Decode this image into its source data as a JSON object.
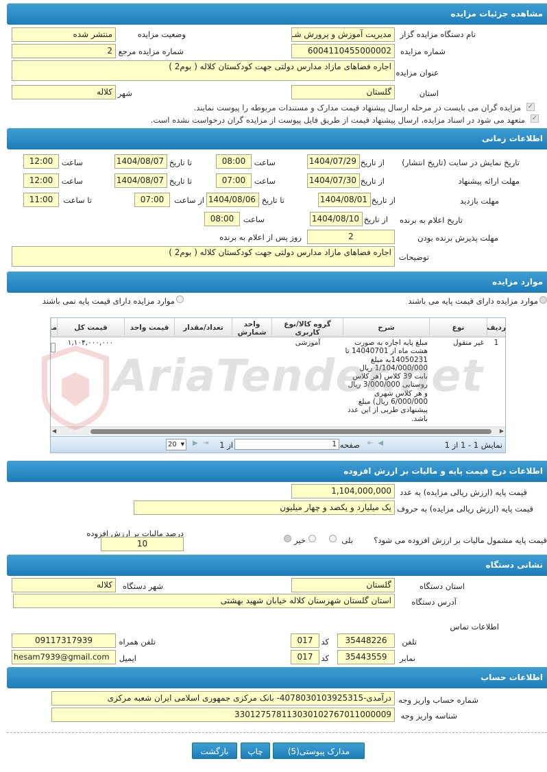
{
  "sections": {
    "details": "مشاهده جزئیات مزایده",
    "timing": "اطلاعات زمانی",
    "items": "موارد مزایده",
    "price": "اطلاعات درج قیمت پایه و مالیات بر ارزش افزوده",
    "address": "نشانی دستگاه",
    "account": "اطلاعات حساب"
  },
  "details": {
    "org_label": "نام دستگاه مزایده گزار",
    "org_value": "مدیریت آموزش و پرورش شـ",
    "status_label": "وضعیت مزایده",
    "status_value": "منتشر شده",
    "number_label": "شماره مزایده",
    "number_value": "6004110455000002",
    "ref_label": "شماره مزایده مرجع",
    "ref_value": "2",
    "title_label": "عنوان مزایده",
    "title_value": "اجاره فضاهای مازاد مدارس دولتی جهت کودکستان کلاله ( بوم2 )",
    "province_label": "استان",
    "province_value": "گلستان",
    "city_label": "شهر",
    "city_value": "کلاله",
    "check1": "مزایده گران می بایست در مرحله ارسال پیشنهاد قیمت مدارک و مستندات مربوطه را پیوست نمایند.",
    "check2": "متعهد می شود در اسناد مزایده، ارسال پیشنهاد قیمت از طریق فایل پیوست از مزایده گران درخواست نشده است."
  },
  "timing": {
    "publish_label": "تاریخ نمایش در سایت (تاریخ انتشار)",
    "from_label": "از تاریخ",
    "to_label": "تا تاریخ",
    "hour_label": "ساعت",
    "publish_from": "1404/07/29",
    "publish_from_time": "08:00",
    "publish_to": "1404/08/07",
    "publish_to_time": "12:00",
    "offer_label": "مهلت ارائه پیشنهاد",
    "offer_from": "1404/07/30",
    "offer_from_time": "07:00",
    "offer_to": "1404/08/07",
    "offer_to_time": "12:00",
    "visit_label": "مهلت بازدید",
    "visit_from": "1404/08/01",
    "visit_to": "1404/08/06",
    "visit_from_hour_label": "از ساعت",
    "visit_from_time": "07:00",
    "visit_to_hour_label": "تا ساعت",
    "visit_to_time": "11:00",
    "winner_label": "تاریخ اعلام به برنده",
    "winner_date": "1404/08/10",
    "winner_time": "08:00",
    "accept_label": "مهلت پذیرش برنده بودن",
    "accept_days": "2",
    "accept_suffix": "روز پس از اعلام به برنده",
    "desc_label": "توضیحات",
    "desc_value": "اجاره فضاهای مازاد مدارس دولتی جهت کودکستان کلاله ( بوم2 )"
  },
  "items": {
    "radio_with": "موارد مزایده دارای قیمت پایه می باشند",
    "radio_without": "موارد مزایده دارای قیمت پایه نمی باشند",
    "columns": [
      "ردیف",
      "نوع",
      "شرح",
      "گروه کالا/نوع کاربری",
      "واحد شمارش",
      "تعداد/مقدار",
      "قیمت واحد",
      "قیمت کل",
      "مد"
    ],
    "row": {
      "index": "1",
      "type": "غیر منقول",
      "desc": "مبلغ پایه اجاره به صورت هشت ماه از 14040701 تا 14050231به مبلغ 1/104/000/000 ریال بابت 39 کلاس (هر کلاس روستایی 3/000/000 ریال و هر کلاس شهری 6/000/000 ریال) مبلغ پیشنهادی طربی از این عدد باشد.",
      "group": "آموزشی",
      "unit": "",
      "qty": "",
      "unit_price": "",
      "total": "۱,۱۰۴,۰۰۰,۰۰۰"
    },
    "pager_display": "نمایش 1 - 1 از 1",
    "page_label": "صفحه",
    "page_value": "1",
    "of_label": "از 1",
    "page_size": "20"
  },
  "price": {
    "base_num_label": "قیمت پایه (ارزش ریالی مزایده) به عدد",
    "base_num_value": "1,104,000,000",
    "base_text_label": "قیمت پایه (ارزش ریالی مزایده) به حروف",
    "base_text_value": "یک میلیارد و یکصد و چهار میلیون",
    "vat_q": "قیمت پایه مشمول مالیات بر ارزش افزوده می شود؟",
    "yes": "بلی",
    "no": "خیر",
    "vat_pct_label": "درصد مالیات بر ارزش افزوده",
    "vat_pct_value": "10"
  },
  "address": {
    "province_label": "استان دستگاه",
    "province_value": "گلستان",
    "city_label": "شهر دستگاه",
    "city_value": "کلاله",
    "addr_label": "آدرس دستگاه",
    "addr_value": "استان گلستان شهرستان کلاله خیابان شهید بهشتی",
    "contact_label": "اطلاعات تماس",
    "phone_label": "تلفن",
    "phone_value": "35448226",
    "code_label": "کد",
    "phone_code": "017",
    "mobile_label": "تلفن همراه",
    "mobile_value": "09117317939",
    "fax_label": "نمابر",
    "fax_value": "35443559",
    "fax_code": "017",
    "email_label": "ایمیل",
    "email_value": "hesam7939@gmail.com"
  },
  "account": {
    "acc_label": "شماره حساب واریز وجه",
    "acc_value": "درآمدی-4078030103925315- بانک مرکزی جمهوری اسلامی ایران شعبه مرکزی",
    "id_label": "شناسه واریز وجه",
    "id_value": "330127578113030102767011000009"
  },
  "buttons": {
    "docs": "مدارک پیوستی(5)",
    "print": "چاپ",
    "back": "بازگشت"
  },
  "watermark": "AriaTender.net"
}
